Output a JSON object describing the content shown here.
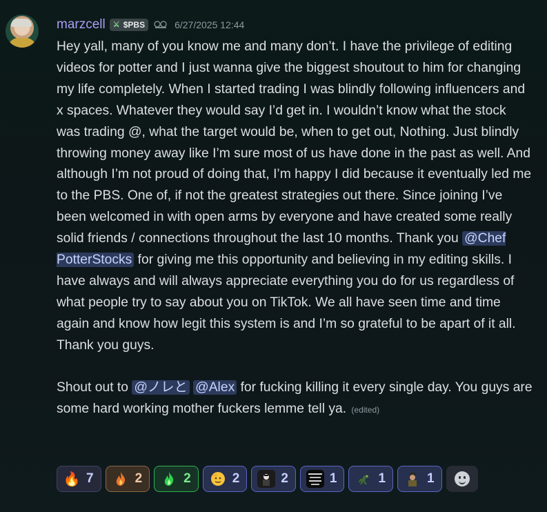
{
  "message": {
    "username": "marzcell",
    "tag": "$PBS",
    "tag_icon": "sword-icon",
    "timestamp": "6/27/2025 12:44",
    "paragraph1_part1": "Hey yall, many of you know me and many don’t. I have the privilege of editing videos for potter and I just wanna give the biggest shoutout to him for changing my life completely. When I started trading I was blindly following influencers and x spaces. Whatever they would say I’d get in. I wouldn’t know what the stock was trading @, what the target would be, when to get out, Nothing. Just blindly throwing money away like I’m sure most of us have done in the past as well. And although I’m not proud of doing that, I’m happy I did because it eventually led me to the PBS. One of, if not the greatest strategies out there. Since joining I’ve been welcomed in with open arms by everyone and have created some really solid friends / connections throughout the last 10 months. Thank you ",
    "mention1": "@Chef PotterStocks",
    "paragraph1_part2": " for giving me this opportunity and believing in my editing skills. I have always and will always appreciate everything you do for us regardless of what people try to say about you on TikTok. We all have seen time and time again and know how legit this system is and  I’m so grateful  to be apart of it all. Thank you guys.",
    "paragraph2_part1": "Shout out to ",
    "mention2": "@ノレと",
    "paragraph2_sep": " ",
    "mention3": "@Alex",
    "paragraph2_part2": " for fucking killing it every single day. You guys are some hard working mother fuckers lemme tell ya.",
    "edited_label": "(edited)"
  },
  "reactions": [
    {
      "emoji": "fire-emoji",
      "glyph": "🔥",
      "count": "7",
      "style": "plain"
    },
    {
      "emoji": "orange-flame-emoji",
      "glyph": "🔥",
      "count": "2",
      "style": "orange"
    },
    {
      "emoji": "green-flame-emoji",
      "glyph": "🔥",
      "count": "2",
      "style": "green"
    },
    {
      "emoji": "saluting-face-emoji",
      "glyph": "🫡",
      "count": "2",
      "style": "blue"
    },
    {
      "emoji": "character-emoji",
      "glyph": "",
      "count": "2",
      "style": "blue"
    },
    {
      "emoji": "trading-club-emoji",
      "glyph": "",
      "count": "1",
      "style": "blue"
    },
    {
      "emoji": "dinosaur-emoji",
      "glyph": "",
      "count": "1",
      "style": "blue"
    },
    {
      "emoji": "cap-character-emoji",
      "glyph": "",
      "count": "1",
      "style": "blue"
    }
  ],
  "colors": {
    "username": "#a99ef5",
    "mention_bg": "#2c3a5c",
    "mention_text": "#c7d3ff",
    "reaction_border": "#5b66c8"
  }
}
